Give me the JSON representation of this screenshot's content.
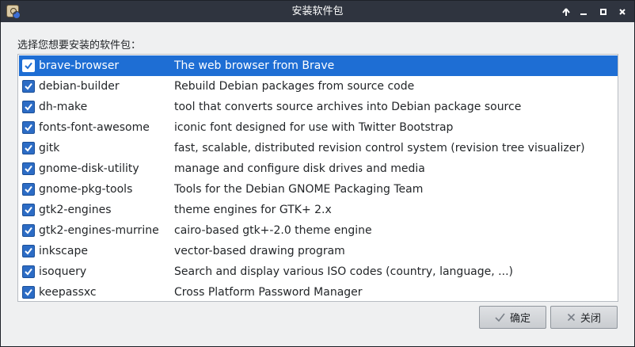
{
  "window": {
    "title": "安装软件包",
    "prompt": "选择您想要安装的软件包："
  },
  "packages": [
    {
      "name": "brave-browser",
      "description": "The web browser from Brave",
      "checked": true,
      "selected": true
    },
    {
      "name": "debian-builder",
      "description": "Rebuild Debian packages from source code",
      "checked": true,
      "selected": false
    },
    {
      "name": "dh-make",
      "description": "tool that converts source archives into Debian package source",
      "checked": true,
      "selected": false
    },
    {
      "name": "fonts-font-awesome",
      "description": "iconic font designed for use with Twitter Bootstrap",
      "checked": true,
      "selected": false
    },
    {
      "name": "gitk",
      "description": "fast, scalable, distributed revision control system (revision tree visualizer)",
      "checked": true,
      "selected": false
    },
    {
      "name": "gnome-disk-utility",
      "description": "manage and configure disk drives and media",
      "checked": true,
      "selected": false
    },
    {
      "name": "gnome-pkg-tools",
      "description": "Tools for the Debian GNOME Packaging Team",
      "checked": true,
      "selected": false
    },
    {
      "name": "gtk2-engines",
      "description": "theme engines for GTK+ 2.x",
      "checked": true,
      "selected": false
    },
    {
      "name": "gtk2-engines-murrine",
      "description": "cairo-based gtk+-2.0 theme engine",
      "checked": true,
      "selected": false
    },
    {
      "name": "inkscape",
      "description": "vector-based drawing program",
      "checked": true,
      "selected": false
    },
    {
      "name": "isoquery",
      "description": "Search and display various ISO codes (country, language, ...)",
      "checked": true,
      "selected": false
    },
    {
      "name": "keepassxc",
      "description": "Cross Platform Password Manager",
      "checked": true,
      "selected": false
    }
  ],
  "buttons": {
    "ok": {
      "label": "确定",
      "icon": "checkmark-icon"
    },
    "close": {
      "label": "关闭",
      "icon": "x-icon"
    }
  },
  "titlebar_icons": [
    "app-icon",
    "keep-above-icon",
    "minimize-icon",
    "maximize-icon",
    "close-icon"
  ],
  "colors": {
    "titlebar": "#2f343f",
    "selection": "#1e6ed4",
    "checkbox": "#2c6cc5",
    "window_bg": "#eff0f1"
  }
}
